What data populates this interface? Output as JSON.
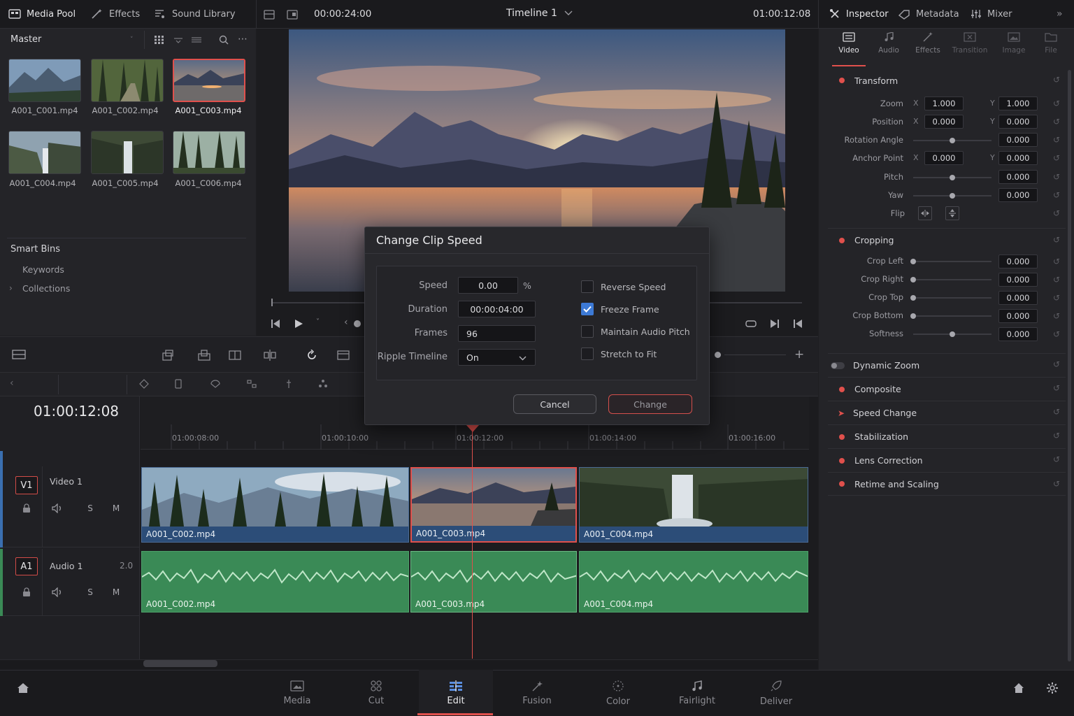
{
  "topbar": {
    "media_pool": "Media Pool",
    "effects": "Effects",
    "sound_library": "Sound Library",
    "timecode_left": "00:00:24:00",
    "timeline_name": "Timeline 1",
    "timecode_right": "01:00:12:08",
    "inspector": "Inspector",
    "metadata": "Metadata",
    "mixer": "Mixer"
  },
  "media_pool": {
    "bin_name": "Master",
    "clips": [
      "A001_C001.mp4",
      "A001_C002.mp4",
      "A001_C003.mp4",
      "A001_C004.mp4",
      "A001_C005.mp4",
      "A001_C006.mp4"
    ],
    "selected_clip": "A001_C003.mp4",
    "smart_bins": "Smart Bins",
    "keywords": "Keywords",
    "collections": "Collections"
  },
  "timeline": {
    "current_timecode": "01:00:12:08",
    "ruler": [
      "01:00:08:00",
      "01:00:10:00",
      "01:00:12:00",
      "01:00:14:00",
      "01:00:16:00"
    ],
    "video_track": {
      "id": "V1",
      "name": "Video 1",
      "clips": [
        "A001_C002.mp4",
        "A001_C003.mp4",
        "A001_C004.mp4"
      ]
    },
    "audio_track": {
      "id": "A1",
      "name": "Audio 1",
      "channels": "2.0",
      "clips": [
        "A001_C002.mp4",
        "A001_C003.mp4",
        "A001_C004.mp4"
      ]
    },
    "solo": "S",
    "mute": "M"
  },
  "dialog": {
    "title": "Change Clip Speed",
    "speed_label": "Speed",
    "speed_value": "0.00",
    "speed_unit": "%",
    "duration_label": "Duration",
    "duration_value": "00:00:04:00",
    "frames_label": "Frames",
    "frames_value": "96",
    "ripple_label": "Ripple Timeline",
    "ripple_value": "On",
    "reverse_speed": "Reverse Speed",
    "freeze_frame": "Freeze Frame",
    "maintain_audio_pitch": "Maintain Audio Pitch",
    "stretch_to_fit": "Stretch to Fit",
    "freeze_frame_checked": true,
    "cancel": "Cancel",
    "change": "Change"
  },
  "inspector": {
    "tabs": [
      "Video",
      "Audio",
      "Effects",
      "Transition",
      "Image",
      "File"
    ],
    "active_tab": "Video",
    "transform": {
      "title": "Transform",
      "zoom_label": "Zoom",
      "zoom_x": "1.000",
      "zoom_y": "1.000",
      "position_label": "Position",
      "position_x": "0.000",
      "position_y": "0.000",
      "rotation_label": "Rotation Angle",
      "rotation": "0.000",
      "anchor_label": "Anchor Point",
      "anchor_x": "0.000",
      "anchor_y": "0.000",
      "pitch_label": "Pitch",
      "pitch": "0.000",
      "yaw_label": "Yaw",
      "yaw": "0.000",
      "flip_label": "Flip",
      "x": "X",
      "y": "Y"
    },
    "cropping": {
      "title": "Cropping",
      "crop_left_label": "Crop Left",
      "crop_left": "0.000",
      "crop_right_label": "Crop Right",
      "crop_right": "0.000",
      "crop_top_label": "Crop Top",
      "crop_top": "0.000",
      "crop_bottom_label": "Crop Bottom",
      "crop_bottom": "0.000",
      "softness_label": "Softness",
      "softness": "0.000"
    },
    "sections": [
      "Dynamic Zoom",
      "Composite",
      "Speed Change",
      "Stabilization",
      "Lens Correction",
      "Retime and Scaling"
    ]
  },
  "pages": [
    "Media",
    "Cut",
    "Edit",
    "Fusion",
    "Color",
    "Fairlight",
    "Deliver"
  ],
  "active_page": "Edit",
  "colors": {
    "accent": "#e0504c",
    "video_clip": "#2c4d78",
    "audio_clip": "#3a8a56",
    "panel": "#242428"
  }
}
